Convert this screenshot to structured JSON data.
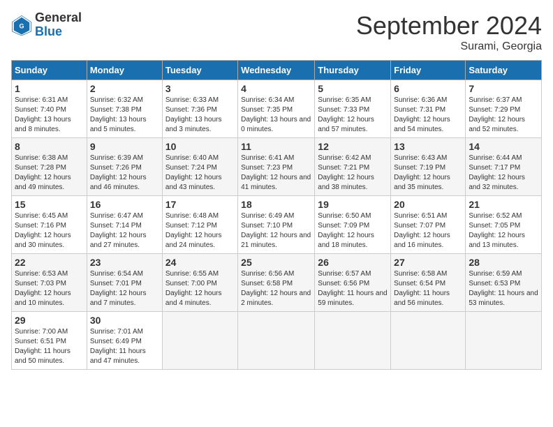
{
  "logo": {
    "general": "General",
    "blue": "Blue"
  },
  "title": "September 2024",
  "subtitle": "Surami, Georgia",
  "weekdays": [
    "Sunday",
    "Monday",
    "Tuesday",
    "Wednesday",
    "Thursday",
    "Friday",
    "Saturday"
  ],
  "weeks": [
    [
      {
        "day": "1",
        "sunrise": "6:31 AM",
        "sunset": "7:40 PM",
        "daylight": "13 hours and 8 minutes."
      },
      {
        "day": "2",
        "sunrise": "6:32 AM",
        "sunset": "7:38 PM",
        "daylight": "13 hours and 5 minutes."
      },
      {
        "day": "3",
        "sunrise": "6:33 AM",
        "sunset": "7:36 PM",
        "daylight": "13 hours and 3 minutes."
      },
      {
        "day": "4",
        "sunrise": "6:34 AM",
        "sunset": "7:35 PM",
        "daylight": "13 hours and 0 minutes."
      },
      {
        "day": "5",
        "sunrise": "6:35 AM",
        "sunset": "7:33 PM",
        "daylight": "12 hours and 57 minutes."
      },
      {
        "day": "6",
        "sunrise": "6:36 AM",
        "sunset": "7:31 PM",
        "daylight": "12 hours and 54 minutes."
      },
      {
        "day": "7",
        "sunrise": "6:37 AM",
        "sunset": "7:29 PM",
        "daylight": "12 hours and 52 minutes."
      }
    ],
    [
      {
        "day": "8",
        "sunrise": "6:38 AM",
        "sunset": "7:28 PM",
        "daylight": "12 hours and 49 minutes."
      },
      {
        "day": "9",
        "sunrise": "6:39 AM",
        "sunset": "7:26 PM",
        "daylight": "12 hours and 46 minutes."
      },
      {
        "day": "10",
        "sunrise": "6:40 AM",
        "sunset": "7:24 PM",
        "daylight": "12 hours and 43 minutes."
      },
      {
        "day": "11",
        "sunrise": "6:41 AM",
        "sunset": "7:23 PM",
        "daylight": "12 hours and 41 minutes."
      },
      {
        "day": "12",
        "sunrise": "6:42 AM",
        "sunset": "7:21 PM",
        "daylight": "12 hours and 38 minutes."
      },
      {
        "day": "13",
        "sunrise": "6:43 AM",
        "sunset": "7:19 PM",
        "daylight": "12 hours and 35 minutes."
      },
      {
        "day": "14",
        "sunrise": "6:44 AM",
        "sunset": "7:17 PM",
        "daylight": "12 hours and 32 minutes."
      }
    ],
    [
      {
        "day": "15",
        "sunrise": "6:45 AM",
        "sunset": "7:16 PM",
        "daylight": "12 hours and 30 minutes."
      },
      {
        "day": "16",
        "sunrise": "6:47 AM",
        "sunset": "7:14 PM",
        "daylight": "12 hours and 27 minutes."
      },
      {
        "day": "17",
        "sunrise": "6:48 AM",
        "sunset": "7:12 PM",
        "daylight": "12 hours and 24 minutes."
      },
      {
        "day": "18",
        "sunrise": "6:49 AM",
        "sunset": "7:10 PM",
        "daylight": "12 hours and 21 minutes."
      },
      {
        "day": "19",
        "sunrise": "6:50 AM",
        "sunset": "7:09 PM",
        "daylight": "12 hours and 18 minutes."
      },
      {
        "day": "20",
        "sunrise": "6:51 AM",
        "sunset": "7:07 PM",
        "daylight": "12 hours and 16 minutes."
      },
      {
        "day": "21",
        "sunrise": "6:52 AM",
        "sunset": "7:05 PM",
        "daylight": "12 hours and 13 minutes."
      }
    ],
    [
      {
        "day": "22",
        "sunrise": "6:53 AM",
        "sunset": "7:03 PM",
        "daylight": "12 hours and 10 minutes."
      },
      {
        "day": "23",
        "sunrise": "6:54 AM",
        "sunset": "7:01 PM",
        "daylight": "12 hours and 7 minutes."
      },
      {
        "day": "24",
        "sunrise": "6:55 AM",
        "sunset": "7:00 PM",
        "daylight": "12 hours and 4 minutes."
      },
      {
        "day": "25",
        "sunrise": "6:56 AM",
        "sunset": "6:58 PM",
        "daylight": "12 hours and 2 minutes."
      },
      {
        "day": "26",
        "sunrise": "6:57 AM",
        "sunset": "6:56 PM",
        "daylight": "11 hours and 59 minutes."
      },
      {
        "day": "27",
        "sunrise": "6:58 AM",
        "sunset": "6:54 PM",
        "daylight": "11 hours and 56 minutes."
      },
      {
        "day": "28",
        "sunrise": "6:59 AM",
        "sunset": "6:53 PM",
        "daylight": "11 hours and 53 minutes."
      }
    ],
    [
      {
        "day": "29",
        "sunrise": "7:00 AM",
        "sunset": "6:51 PM",
        "daylight": "11 hours and 50 minutes."
      },
      {
        "day": "30",
        "sunrise": "7:01 AM",
        "sunset": "6:49 PM",
        "daylight": "11 hours and 47 minutes."
      },
      null,
      null,
      null,
      null,
      null
    ]
  ]
}
